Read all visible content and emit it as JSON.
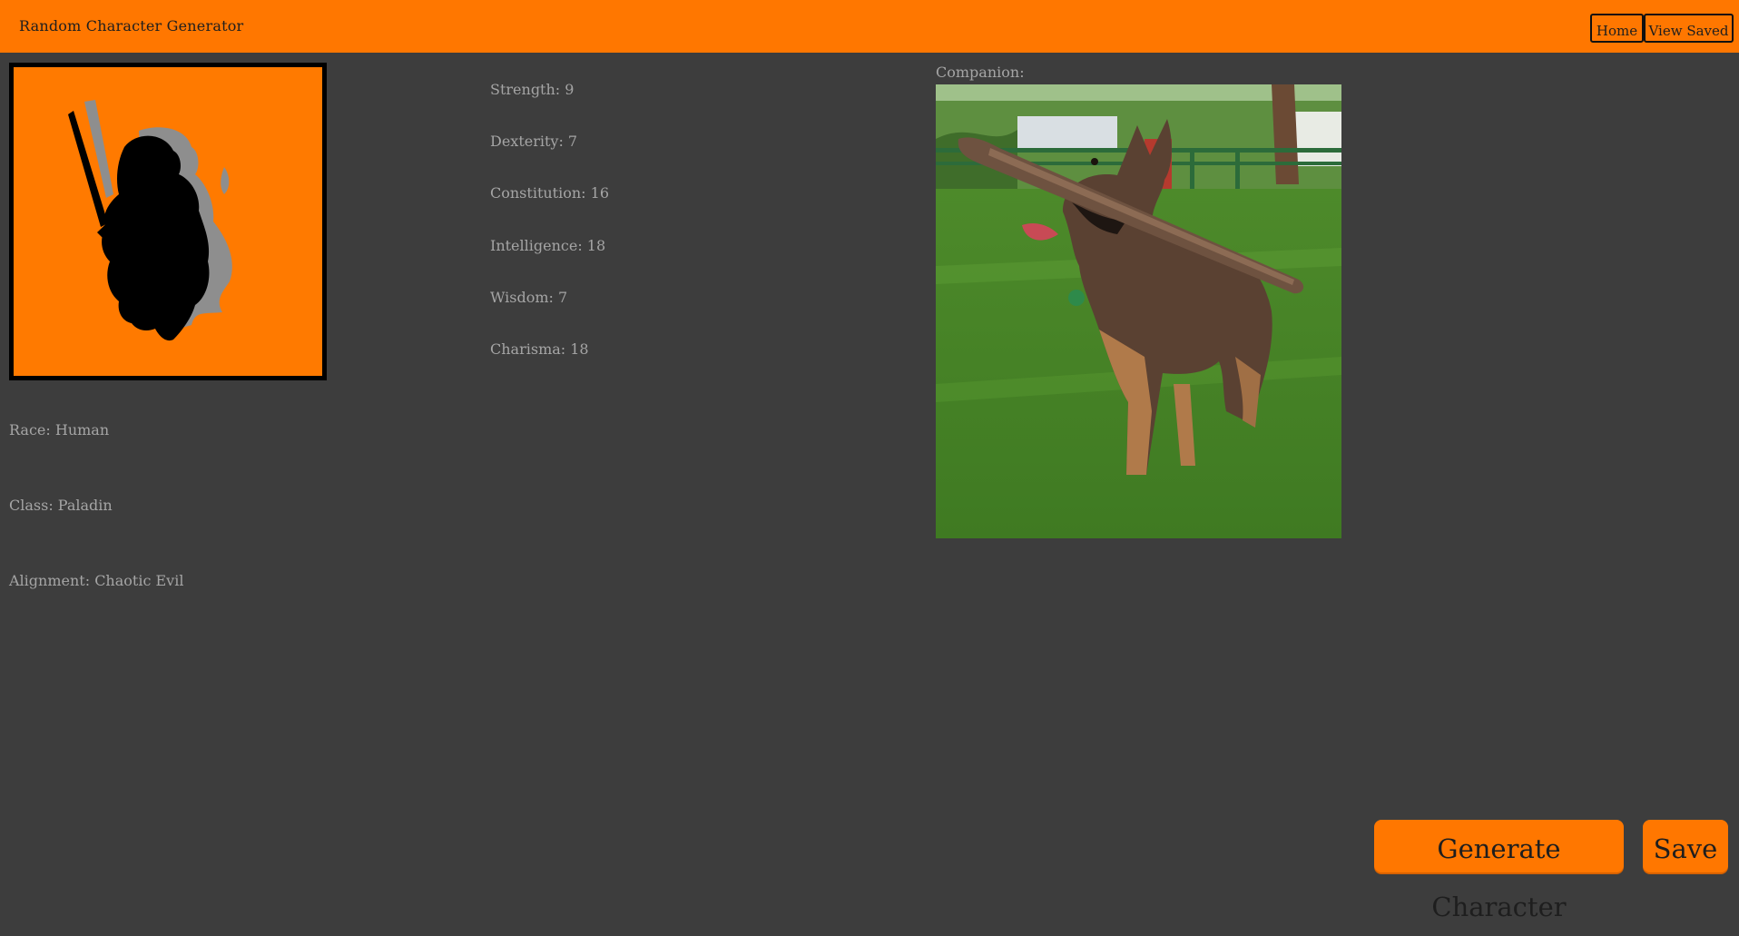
{
  "header": {
    "title": "Random Character Generator",
    "nav": [
      {
        "label": "Home"
      },
      {
        "label": "View Saved"
      }
    ]
  },
  "portrait": {
    "icon": "paladin-silhouette-icon",
    "background_color": "#ff7a00"
  },
  "character": {
    "race": "Race: Human",
    "class": "Class: Paladin",
    "alignment": "Alignment: Chaotic Evil"
  },
  "stats": [
    {
      "text": "Strength: 9"
    },
    {
      "text": "Dexterity: 7"
    },
    {
      "text": "Constitution: 16"
    },
    {
      "text": "Intelligence: 18"
    },
    {
      "text": "Wisdom: 7"
    },
    {
      "text": "Charisma: 18"
    }
  ],
  "companion": {
    "label": "Companion:",
    "image_subject": "dog-holding-stick"
  },
  "actions": {
    "generate_label": "Generate Character",
    "save_label": "Save"
  },
  "colors": {
    "accent": "#ff7700",
    "background": "#3d3d3d",
    "text": "#a5a5a5"
  }
}
